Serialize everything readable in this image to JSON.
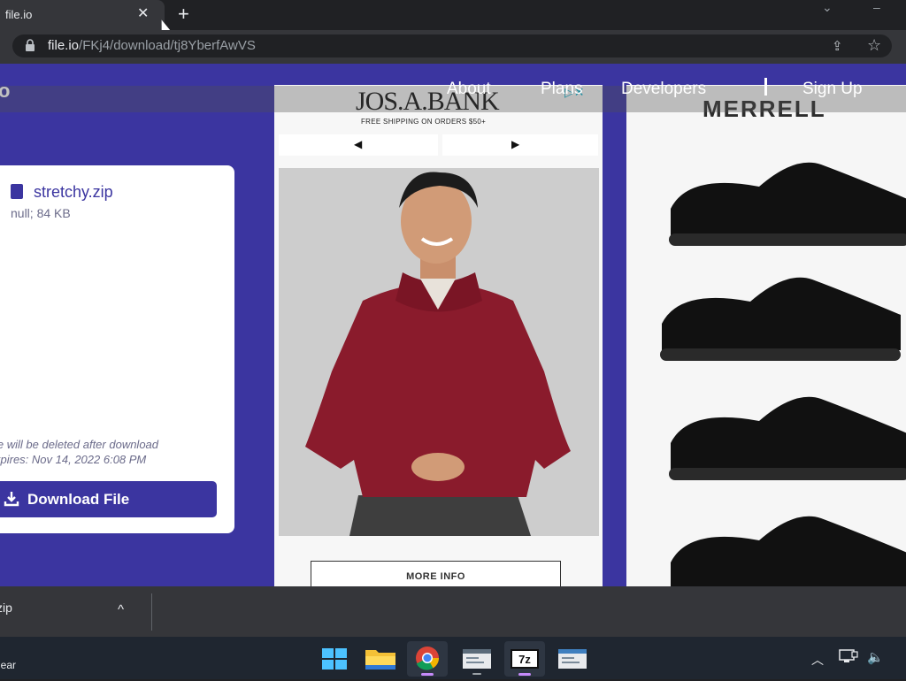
{
  "browser": {
    "tab_title": "file.io",
    "tab_close": "✕",
    "new_tab": "+",
    "url_host": "file.io",
    "url_path": "/FKj4/download/tj8YberfAwVS"
  },
  "site": {
    "logo_partial": "o",
    "nav": {
      "about": "About",
      "plans": "Plans",
      "developers": "Developers",
      "sign_up": "Sign Up"
    }
  },
  "file_card": {
    "file_name": "stretchy.zip",
    "file_meta": "null; 84 KB",
    "notice_delete": "le will be deleted after download",
    "notice_expires": "xpires: Nov 14, 2022 6:08 PM",
    "download_label": "Download File",
    "accent_color": "#3b35a0"
  },
  "ads": {
    "jos_a_bank": {
      "brand": "JOS.A.BANK",
      "tagline": "FREE SHIPPING ON ORDERS $50+",
      "prev": "◀",
      "next": "▶",
      "cta": "MORE INFO",
      "ad_choices": "▷✕"
    },
    "merrell": {
      "brand": "MERRELL"
    }
  },
  "downloads_shelf": {
    "item_label": "zip",
    "chevron": "^"
  },
  "taskbar": {
    "clear_label": "lear",
    "apps": [
      "start-icon",
      "file-explorer-icon",
      "chrome-icon",
      "app-icon",
      "7zip-icon",
      "app-icon-2"
    ]
  }
}
